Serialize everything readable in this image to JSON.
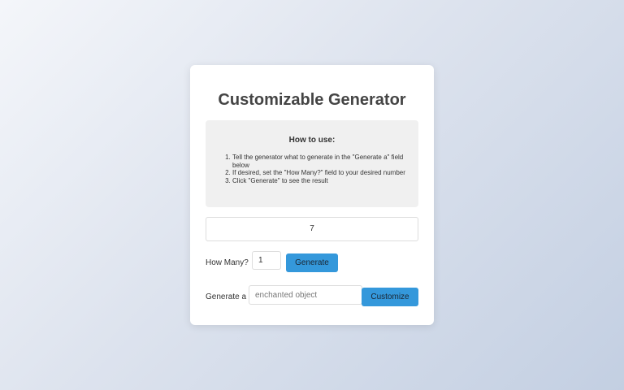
{
  "card": {
    "title": "Customizable Generator"
  },
  "instructions": {
    "title": "How to use:",
    "steps": [
      "Tell the generator what to generate in the \"Generate a\" field below",
      "If desired, set the \"How Many?\" field to your desired number",
      "Click \"Generate\" to see the result"
    ]
  },
  "result": {
    "value": "7"
  },
  "controls": {
    "how_many_label": "How Many?",
    "how_many_value": "1",
    "generate_label": "Generate",
    "generate_a_label": "Generate a",
    "generate_a_placeholder": "enchanted object",
    "customize_label": "Customize"
  },
  "colors": {
    "accent": "#3498db",
    "card_bg": "#ffffff",
    "instructions_bg": "#f0f0f0"
  }
}
